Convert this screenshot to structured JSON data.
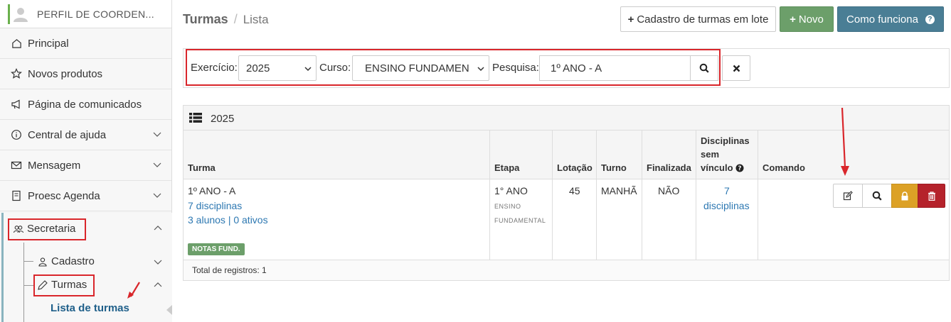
{
  "sidebar": {
    "profile_name": "PERFIL DE COORDEN...",
    "items": [
      {
        "label": "Principal"
      },
      {
        "label": "Novos produtos"
      },
      {
        "label": "Página de comunicados"
      },
      {
        "label": "Central de ajuda"
      },
      {
        "label": "Mensagem"
      },
      {
        "label": "Proesc Agenda"
      },
      {
        "label": "Secretaria"
      }
    ],
    "sub": {
      "cadastro": "Cadastro",
      "turmas": "Turmas",
      "lista": "Lista de turmas"
    }
  },
  "header": {
    "title": "Turmas",
    "separator": "/",
    "subtitle": "Lista",
    "btn_lote": "Cadastro de turmas em lote",
    "btn_novo": "Novo",
    "btn_como": "Como funciona",
    "plus_glyph": "+",
    "help_glyph": "?"
  },
  "filters": {
    "exercicio_label": "Exercício:",
    "exercicio_value": "2025",
    "curso_label": "Curso:",
    "curso_value": "ENSINO FUNDAMENT",
    "pesquisa_label": "Pesquisa:",
    "pesquisa_value": "1º ANO - A"
  },
  "table": {
    "year": "2025",
    "columns": {
      "turma": "Turma",
      "etapa": "Etapa",
      "lotacao": "Lotação",
      "turno": "Turno",
      "finalizada": "Finalizada",
      "disc_l1": "Disciplinas",
      "disc_l2": "sem",
      "disc_l3": "vínculo",
      "comando": "Comando"
    },
    "rows": [
      {
        "turma": "1º ANO - A",
        "disciplinas": "7 disciplinas",
        "alunos": "3 alunos | 0 ativos",
        "badge": "NOTAS FUND.",
        "etapa": "1° ANO",
        "etapa_sub1": "ENSINO",
        "etapa_sub2": "FUNDAMENTAL",
        "lotacao": "45",
        "turno": "MANHÃ",
        "finalizada": "NÃO",
        "disc_sem_vinculo_1": "7",
        "disc_sem_vinculo_2": "disciplinas"
      }
    ],
    "footer": "Total de registros: 1"
  },
  "colors": {
    "accent_green": "#6c9f6a",
    "accent_blue": "#4a7e95",
    "link": "#2d78b2",
    "lock": "#dca126",
    "delete": "#b5222b",
    "highlight": "#d9262b"
  }
}
